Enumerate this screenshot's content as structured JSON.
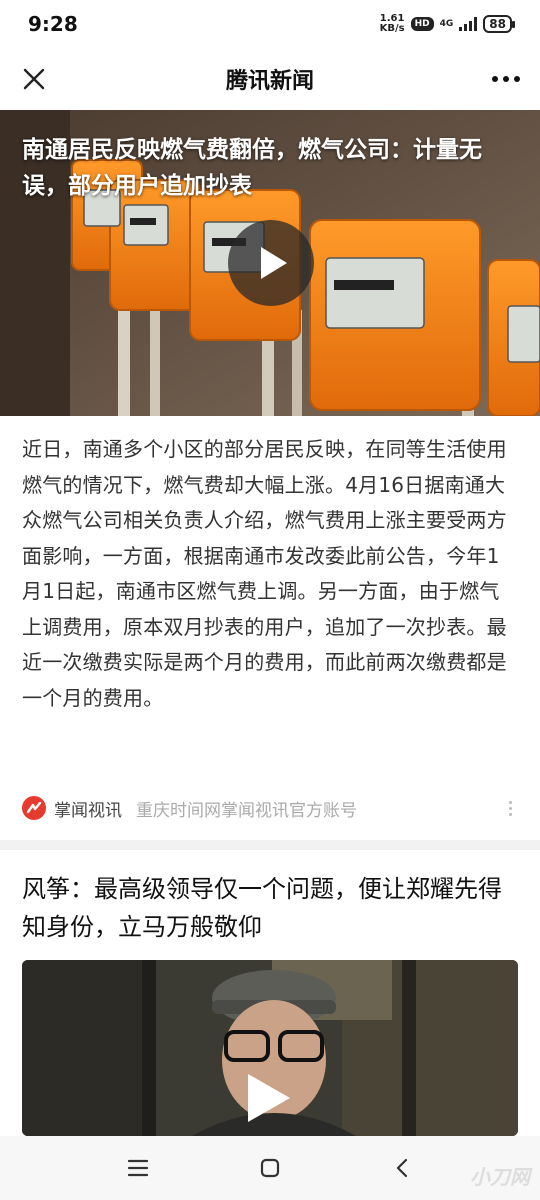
{
  "status": {
    "time": "9:28",
    "net_speed_value": "1.61",
    "net_speed_unit": "KB/s",
    "hd": "HD",
    "network": "4G",
    "battery": "88"
  },
  "nav": {
    "title": "腾讯新闻"
  },
  "article": {
    "headline": "南通居民反映燃气费翻倍，燃气公司：计量无误，部分用户追加抄表",
    "body": "近日，南通多个小区的部分居民反映，在同等生活使用燃气的情况下，燃气费却大幅上涨。4月16日据南通大众燃气公司相关负责人介绍，燃气费用上涨主要受两方面影响，一方面，根据南通市发改委此前公告，今年1月1日起，南通市区燃气费上调。另一方面，由于燃气上调费用，原本双月抄表的用户，追加了一次抄表。最近一次缴费实际是两个月的费用，而此前两次缴费都是一个月的费用。",
    "source_name": "掌闻视讯",
    "source_desc": "重庆时间网掌闻视讯官方账号"
  },
  "next_card": {
    "title": "风筝：最高级领导仅一个问题，便让郑耀先得知身份，立马万般敬仰"
  },
  "watermark": "小刀网",
  "colors": {
    "source_logo": "#e63b2e",
    "meter_orange": "#f07a12"
  },
  "icons": {
    "close": "close-icon",
    "more": "more-icon",
    "play": "play-icon",
    "nav_menu": "menu-icon",
    "nav_home": "home-icon",
    "nav_back": "back-icon"
  }
}
